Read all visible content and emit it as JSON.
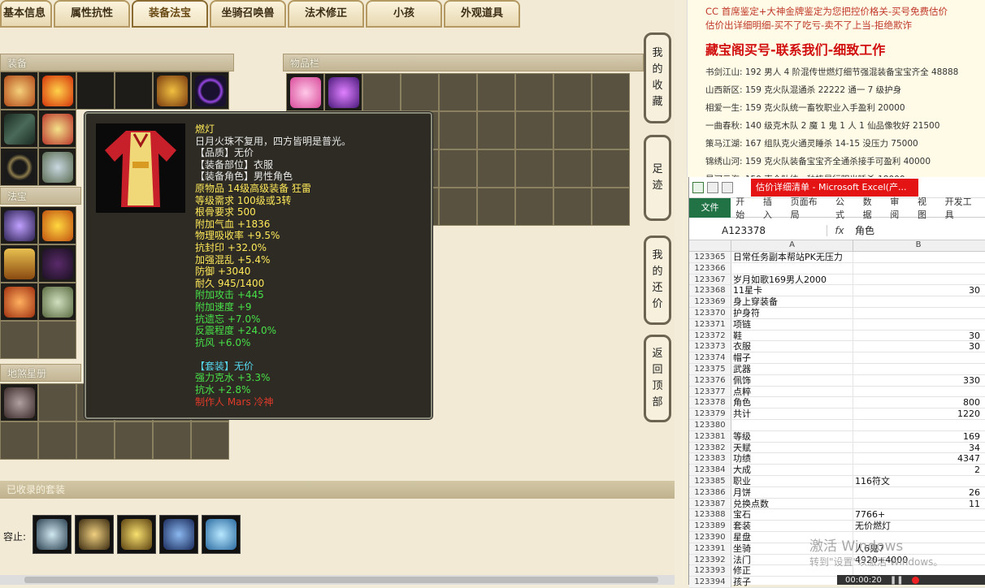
{
  "tabs": [
    "基本信息",
    "属性抗性",
    "装备法宝",
    "坐骑召唤兽",
    "法术修正",
    "小孩",
    "外观道具"
  ],
  "active_tab": 2,
  "sections": {
    "equipment": "装备",
    "inventory": "物品栏",
    "magic": "法宝",
    "stars": "地煞星册",
    "suites": "已收录的套装"
  },
  "suite_label": "容止:",
  "side_buttons": [
    {
      "lines": [
        "我",
        "的",
        "收",
        "藏"
      ]
    },
    {
      "lines": [
        "足",
        "迹"
      ]
    },
    {
      "lines": [
        "我",
        "的",
        "还",
        "价"
      ]
    },
    {
      "lines": [
        "返",
        "回",
        "顶",
        "部"
      ]
    }
  ],
  "tooltip": {
    "name": "燃灯",
    "lines": [
      {
        "text": "日月火珠不复用，四方皆明是普光。",
        "color": "white"
      },
      {
        "text": "【品质】无价",
        "color": "white"
      },
      {
        "text": "【装备部位】衣服",
        "color": "white"
      },
      {
        "text": "【装备角色】男性角色",
        "color": "white"
      },
      {
        "text": "原物品 14级高级装备 狂雷",
        "color": "yellow"
      },
      {
        "text": "等级需求 100级或3转",
        "color": "yellow"
      },
      {
        "text": "根骨要求 500",
        "color": "yellow"
      },
      {
        "text": "附加气血 +1836",
        "color": "yellow"
      },
      {
        "text": "物理吸收率 +9.5%",
        "color": "yellow"
      },
      {
        "text": "抗封印 +32.0%",
        "color": "yellow"
      },
      {
        "text": "加强混乱 +5.4%",
        "color": "yellow"
      },
      {
        "text": "防御 +3040",
        "color": "yellow"
      },
      {
        "text": "耐久 945/1400",
        "color": "yellow"
      },
      {
        "text": "附加攻击 +445",
        "color": "green"
      },
      {
        "text": "附加速度 +9",
        "color": "green"
      },
      {
        "text": "抗遗忘 +7.0%",
        "color": "green"
      },
      {
        "text": "反震程度 +24.0%",
        "color": "green"
      },
      {
        "text": "抗风 +6.0%",
        "color": "green"
      },
      {
        "text": "",
        "color": "white"
      },
      {
        "text": "【套装】无价",
        "color": "cyan"
      },
      {
        "text": "强力克水 +3.3%",
        "color": "green"
      },
      {
        "text": "抗水 +2.8%",
        "color": "green"
      },
      {
        "text": "制作人 Mars    冷神",
        "color": "red"
      }
    ]
  },
  "ad": {
    "lines": [
      "CC 首席鉴定+大神金牌鉴定为您把控价格关-买号免费估价",
      "估价出详细明细-买不了吃亏-卖不了上当-拒绝欺诈"
    ],
    "headline": "藏宝阁买号-联系我们-细致工作",
    "listings": [
      "书剑江山: 192 男人 4 阶混传世燃灯细节强混装备宝宝齐全 48888",
      "山西新区: 159 克火队混通杀 22222 通一 7 级护身",
      "相爱一生: 159 克火队统一畜牧职业入手盈利 20000",
      "一曲春秋: 140 级克木队 2 魔 1 鬼 1 人 1 仙品像牧好 21500",
      "策马江湖: 167 组队克火通灵睡杀 14-15 没压力 75000",
      "锦绣山河: 159 克火队装备宝宝齐全通杀接手可盈利 40000",
      "星河云海: 159 克全队统一种植暴行明光睡杀 18000"
    ]
  },
  "excel": {
    "title": "估价详细清单 - Microsoft Excel(产...",
    "file_tab": "文件",
    "menus": [
      "开始",
      "插入",
      "页面布局",
      "公式",
      "数据",
      "审阅",
      "视图",
      "开发工具"
    ],
    "name_box": "A123378",
    "fx": "fx",
    "formula_value": "角色",
    "col_a": "A",
    "col_b": "B",
    "rows": [
      {
        "n": "123365",
        "a": "日常任务副本帮站PK无压力",
        "b": "",
        "t": "txt"
      },
      {
        "n": "123366",
        "a": "",
        "b": "",
        "t": "txt"
      },
      {
        "n": "123367",
        "a": "岁月如歌169男人2000",
        "b": "",
        "t": "txt"
      },
      {
        "n": "123368",
        "a": "11星卡",
        "b": "30",
        "t": "num"
      },
      {
        "n": "123369",
        "a": "身上穿装备",
        "b": "",
        "t": "txt"
      },
      {
        "n": "123370",
        "a": "护身符",
        "b": "",
        "t": "txt"
      },
      {
        "n": "123371",
        "a": "项链",
        "b": "",
        "t": "txt"
      },
      {
        "n": "123372",
        "a": "鞋",
        "b": "30",
        "t": "num"
      },
      {
        "n": "123373",
        "a": "衣服",
        "b": "30",
        "t": "num"
      },
      {
        "n": "123374",
        "a": "帽子",
        "b": "",
        "t": "txt"
      },
      {
        "n": "123375",
        "a": "武器",
        "b": "",
        "t": "txt"
      },
      {
        "n": "123376",
        "a": "佩饰",
        "b": "330",
        "t": "num"
      },
      {
        "n": "123377",
        "a": "点粹",
        "b": "",
        "t": "txt"
      },
      {
        "n": "123378",
        "a": "角色",
        "b": "800",
        "t": "num"
      },
      {
        "n": "123379",
        "a": "共计",
        "b": "1220",
        "t": "num"
      },
      {
        "n": "123380",
        "a": "",
        "b": "",
        "t": "txt"
      },
      {
        "n": "123381",
        "a": "等级",
        "b": "169",
        "t": "num"
      },
      {
        "n": "123382",
        "a": "天赋",
        "b": "34",
        "t": "num"
      },
      {
        "n": "123383",
        "a": "功绩",
        "b": "4347",
        "t": "num"
      },
      {
        "n": "123384",
        "a": "大成",
        "b": "2",
        "t": "num"
      },
      {
        "n": "123385",
        "a": "职业",
        "b": "116符文",
        "t": "txt"
      },
      {
        "n": "123386",
        "a": "月饼",
        "b": "26",
        "t": "num"
      },
      {
        "n": "123387",
        "a": "兑换点数",
        "b": "11",
        "t": "num"
      },
      {
        "n": "123388",
        "a": "宝石",
        "b": "7766+",
        "t": "txt"
      },
      {
        "n": "123389",
        "a": "套装",
        "b": "无价燃灯",
        "t": "txt"
      },
      {
        "n": "123390",
        "a": "星盘",
        "b": "",
        "t": "txt"
      },
      {
        "n": "123391",
        "a": "坐骑",
        "b": "人6鬼7",
        "t": "txt"
      },
      {
        "n": "123392",
        "a": "法门",
        "b": "4920+4000",
        "t": "txt"
      },
      {
        "n": "123393",
        "a": "修正",
        "b": "",
        "t": "txt"
      },
      {
        "n": "123394",
        "a": "孩子",
        "b": "",
        "t": "txt"
      }
    ]
  },
  "watermark": {
    "line1": "激活 Windows",
    "line2": "转到\"设置\"以激活 Windows。"
  },
  "recorder": {
    "time": "00:00:20"
  },
  "colors": {
    "tooltip_bg": "#2d2b24",
    "accent_red": "#d10e0e",
    "excel_green": "#217346"
  }
}
